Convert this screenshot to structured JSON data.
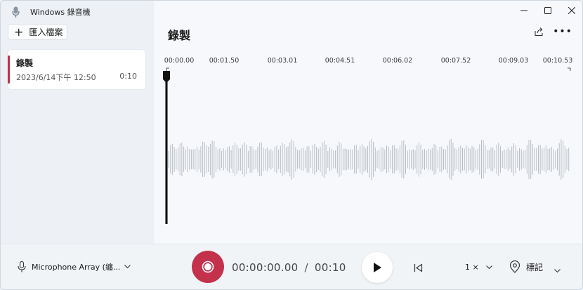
{
  "app": {
    "title": "Windows 錄音機"
  },
  "sidebar": {
    "import_label": "匯入檔案",
    "recordings": [
      {
        "name": "錄製",
        "date": "2023/6/14下午 12:50",
        "duration": "0:10",
        "selected": true
      }
    ]
  },
  "main": {
    "title": "錄製",
    "timeline_ticks": [
      "00:00.00",
      "00:01.50",
      "00:03.01",
      "00:04.51",
      "00:06.02",
      "00:07.52",
      "00:09.03",
      "00:10.53"
    ]
  },
  "playback": {
    "microphone": "Microphone Array (纏...",
    "current_time": "00:00:00.00",
    "total_time": "00:10",
    "speed": "1 ×",
    "marker_label": "標記"
  },
  "colors": {
    "record": "#c4314b",
    "accent": "#c4314b"
  }
}
